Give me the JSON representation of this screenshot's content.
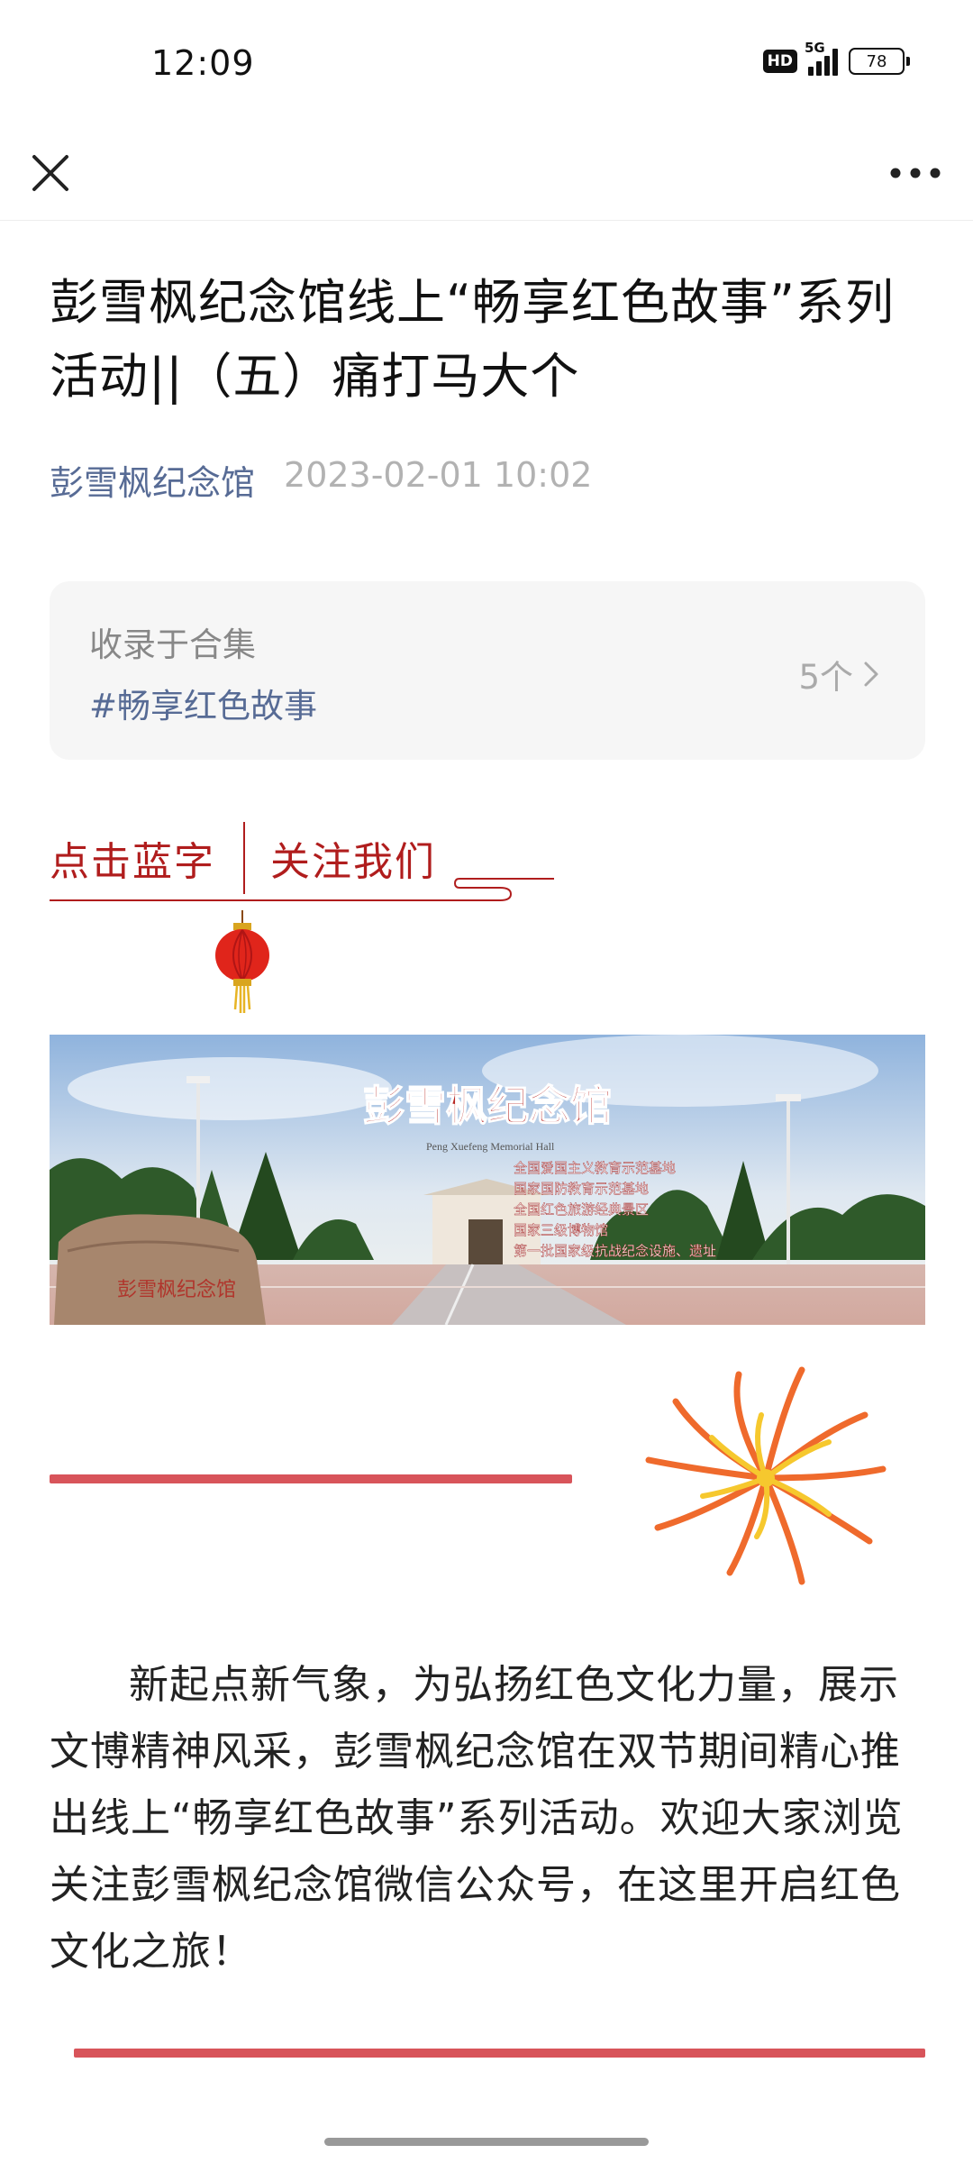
{
  "status_bar": {
    "time": "12:09",
    "hd": "HD",
    "network": "5G",
    "battery": "78"
  },
  "nav": {
    "close_icon": "close-icon",
    "more_icon": "more-icon"
  },
  "article": {
    "title": "彭雪枫纪念馆线上“畅享红色故事”系列活动||（五）痛打马大个",
    "author": "彭雪枫纪念馆",
    "date": "2023-02-01 10:02"
  },
  "collection": {
    "label": "收录于合集",
    "tag": "#畅享红色故事",
    "count": "5个"
  },
  "follow": {
    "left": "点击蓝字",
    "right": "关注我们"
  },
  "banner": {
    "title": "彭雪枫纪念馆",
    "subtitle": "Peng Xuefeng Memorial Hall",
    "honors": [
      "全国爱国主义教育示范基地",
      "国家国防教育示范基地",
      "全国红色旅游经典景区",
      "国家三级博物馆",
      "第一批国家级抗战纪念设施、遗址"
    ],
    "stone_text": "彭雪枫纪念馆"
  },
  "body": {
    "paragraph": "新起点新气象，为弘扬红色文化力量，展示文博精神风采，彭雪枫纪念馆在双节期间精心推出线上“畅享红色故事”系列活动。欢迎大家浏览关注彭雪枫纪念馆微信公众号，在这里开启红色文化之旅！"
  },
  "colors": {
    "accent_red": "#b01d1d",
    "line_red": "#d8545a",
    "link_blue": "#576b95"
  }
}
